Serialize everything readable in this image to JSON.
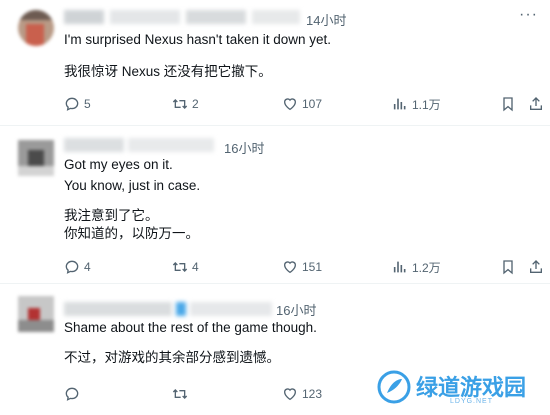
{
  "tweets": [
    {
      "time": "14小时",
      "more": "···",
      "lines": [
        "I'm surprised Nexus hasn't taken it down yet.",
        "我很惊讶 Nexus 还没有把它撤下。"
      ],
      "replies": "5",
      "retweets": "2",
      "likes": "107",
      "views": "1.1万"
    },
    {
      "time": "16小时",
      "lines": [
        "Got my eyes on it.",
        "You know, just in case.",
        "我注意到了它。",
        "你知道的，以防万一。"
      ],
      "replies": "4",
      "retweets": "4",
      "likes": "151",
      "views": "1.2万"
    },
    {
      "time": "16小时",
      "lines": [
        "Shame about the rest of the game though.",
        "不过，对游戏的其余部分感到遗憾。"
      ],
      "replies": "",
      "retweets": "",
      "likes": "123",
      "views": ""
    }
  ],
  "watermark": {
    "text": "绿道游戏园",
    "sub": "LDYG.NET"
  },
  "colors": {
    "text": "#0f1419",
    "muted": "#536471",
    "divider": "#eff3f4",
    "watermark": "#3aa0e6"
  }
}
